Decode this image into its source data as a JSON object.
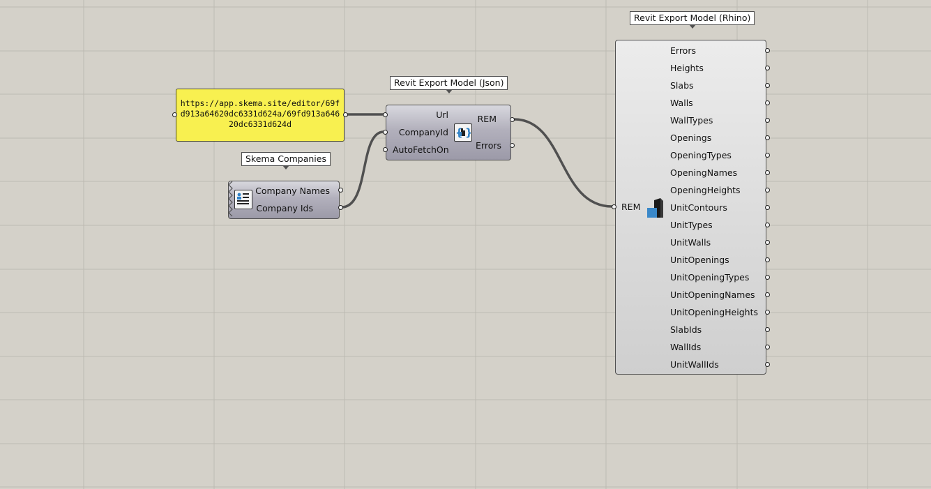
{
  "panel": {
    "text": "https://app.skema.site/editor/69fd913a64620dc6331d624a/69fd913a64620dc6331d624d"
  },
  "json_component": {
    "tooltip": "Revit Export Model (Json)",
    "inputs": [
      "Url",
      "CompanyId",
      "AutoFetchOn"
    ],
    "outputs": [
      "REM",
      "Errors"
    ],
    "icon": "revit-export-json-icon"
  },
  "companies_component": {
    "tooltip": "Skema Companies",
    "outputs": [
      "Company Names",
      "Company Ids"
    ],
    "icon": "company-list-icon"
  },
  "rhino_component": {
    "tooltip": "Revit Export Model (Rhino)",
    "input": "REM",
    "icon": "revit-export-rhino-icon",
    "outputs": [
      "Errors",
      "Heights",
      "Slabs",
      "Walls",
      "WallTypes",
      "Openings",
      "OpeningTypes",
      "OpeningNames",
      "OpeningHeights",
      "UnitContours",
      "UnitTypes",
      "UnitWalls",
      "UnitOpenings",
      "UnitOpeningTypes",
      "UnitOpeningNames",
      "UnitOpeningHeights",
      "SlabIds",
      "WallIds",
      "UnitWallIds"
    ]
  },
  "colors": {
    "canvas": "#d4d1c9",
    "grid": "#bdbab2",
    "panel": "#f8f050",
    "wire": "#505050"
  }
}
